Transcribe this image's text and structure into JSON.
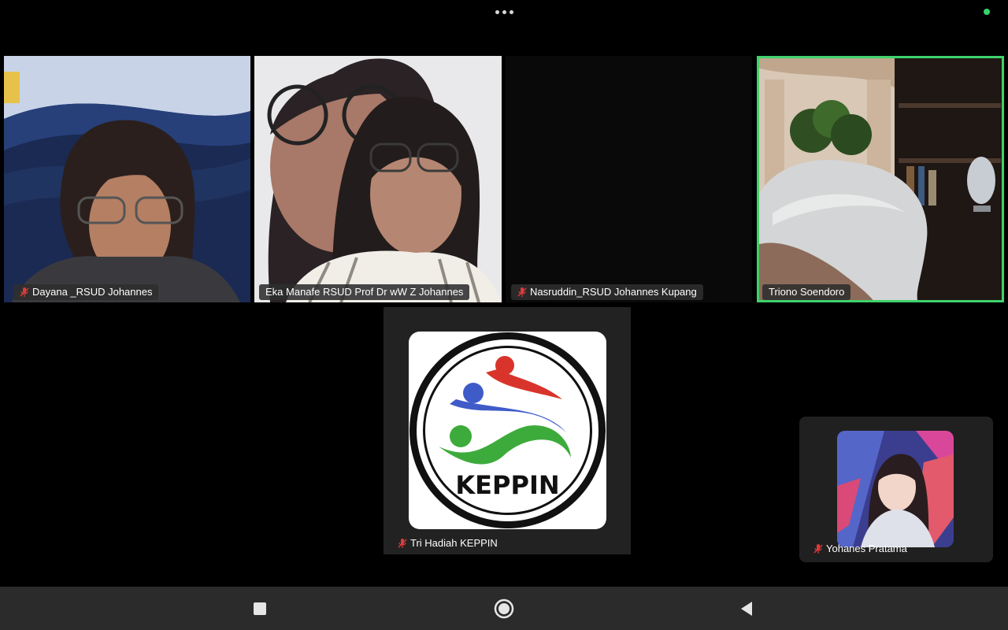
{
  "top_bar": {
    "more_icon": "more-horizontal-icon",
    "status_color": "#35d36b"
  },
  "participants": [
    {
      "name": "Dayana _RSUD Johannes",
      "muted": true
    },
    {
      "name": "Eka  Manafe RSUD Prof Dr wW Z Johannes",
      "muted": false
    },
    {
      "name": "Nasruddin_RSUD Johannes Kupang",
      "muted": true
    },
    {
      "name": "Triono Soendoro",
      "muted": false,
      "active_speaker": true
    },
    {
      "name": "Tri Hadiah KEPPIN",
      "muted": true
    }
  ],
  "keppin_logo": {
    "text": "KEPPIN",
    "colors": {
      "red": "#d9342b",
      "blue": "#3f5bc8",
      "green": "#3dab3b"
    }
  },
  "self_view": {
    "name": "Yohanes Pratama",
    "muted": true
  },
  "navbar": {
    "recents_icon": "square-icon",
    "home_icon": "circle-icon",
    "back_icon": "triangle-back-icon"
  },
  "colors": {
    "active_speaker_border": "#3fd26b",
    "mute_icon": "#e03a3a"
  }
}
